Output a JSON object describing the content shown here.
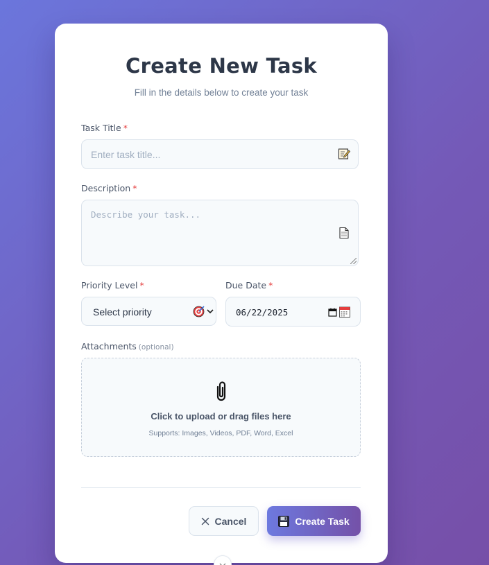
{
  "form": {
    "title": "Create New Task",
    "subtitle": "Fill in the details below to create your task",
    "required_marker": "*",
    "task_title": {
      "label": "Task Title",
      "placeholder": "Enter task title...",
      "value": "",
      "icon": "memo-icon"
    },
    "description": {
      "label": "Description",
      "placeholder": "Describe your task...",
      "value": "",
      "icon": "page-icon"
    },
    "priority": {
      "label": "Priority Level",
      "selected": "Select priority",
      "icon": "target-icon"
    },
    "due_date": {
      "label": "Due Date",
      "value": "06/22/2025",
      "icon": "calendar-icon"
    },
    "attachments": {
      "label": "Attachments",
      "optional": "(optional)",
      "main_text": "Click to upload or drag files here",
      "sub_text": "Supports: Images, Videos, PDF, Word, Excel",
      "icon": "paperclip-icon"
    },
    "actions": {
      "cancel": "Cancel",
      "create": "Create Task"
    }
  },
  "colors": {
    "background_start": "#6b76dc",
    "background_end": "#764fa8",
    "title": "#2d3748",
    "required": "#e53e3e",
    "primary_start": "#6d79df",
    "primary_end": "#7451a8"
  }
}
